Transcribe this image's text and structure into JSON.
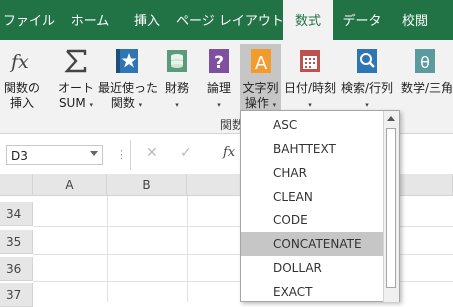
{
  "ribbon": {
    "tabs": [
      "ファイル",
      "ホーム",
      "挿入",
      "ページ レイアウト",
      "数式",
      "データ",
      "校閲"
    ],
    "active_tab": "数式",
    "buttons": [
      {
        "line1": "関数の",
        "line2": "挿入",
        "icon": "fx-icon"
      },
      {
        "line1": "オート",
        "line2": "SUM",
        "icon": "sigma-icon"
      },
      {
        "line1": "最近使った",
        "line2": "関数",
        "icon": "star-book-icon"
      },
      {
        "line1": "財務",
        "line2": "",
        "icon": "coins-icon"
      },
      {
        "line1": "論理",
        "line2": "",
        "icon": "question-icon"
      },
      {
        "line1": "文字列",
        "line2": "操作",
        "icon": "text-a-icon"
      },
      {
        "line1": "日付/時刻",
        "line2": "",
        "icon": "calendar-icon"
      },
      {
        "line1": "検索/行列",
        "line2": "",
        "icon": "magnifier-icon"
      },
      {
        "line1": "数学/三角",
        "line2": "",
        "icon": "theta-icon"
      }
    ],
    "group_label": "関数"
  },
  "formula_bar": {
    "name_box": "D3",
    "dots": "⋮",
    "cancel": "✕",
    "enter": "✓",
    "fx": "fx"
  },
  "grid": {
    "columns": [
      "A",
      "B"
    ],
    "rows": [
      "34",
      "35",
      "36",
      "37"
    ]
  },
  "dropdown": {
    "items": [
      "ASC",
      "BAHTTEXT",
      "CHAR",
      "CLEAN",
      "CODE",
      "CONCATENATE",
      "DOLLAR",
      "EXACT"
    ],
    "highlighted": "CONCATENATE"
  },
  "colors": {
    "brand_green": "#217346",
    "ribbon_bg": "#f2f2f2",
    "pressed": "#c6c6c6"
  }
}
